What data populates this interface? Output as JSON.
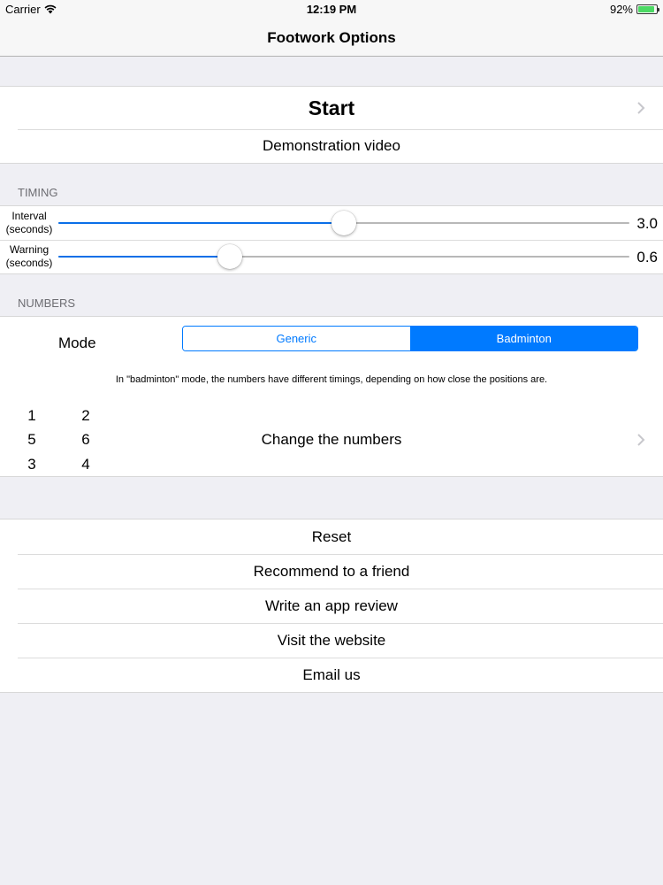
{
  "status": {
    "carrier": "Carrier",
    "time": "12:19 PM",
    "battery": "92%",
    "battery_level": 0.92
  },
  "nav": {
    "title": "Footwork Options"
  },
  "main": {
    "start": "Start",
    "demo": "Demonstration video"
  },
  "timing": {
    "header": "TIMING",
    "interval": {
      "label1": "Interval",
      "label2": "(seconds)",
      "value": "3.0",
      "fraction": 0.5
    },
    "warning": {
      "label1": "Warning",
      "label2": "(seconds)",
      "value": "0.6",
      "fraction": 0.3
    }
  },
  "numbers": {
    "header": "NUMBERS",
    "mode_label": "Mode",
    "options": [
      "Generic",
      "Badminton"
    ],
    "selected": "Badminton",
    "note": "In \"badminton\" mode, the numbers have different timings, depending on how close the positions are.",
    "grid": [
      "1",
      "2",
      "5",
      "6",
      "3",
      "4"
    ],
    "change": "Change the numbers"
  },
  "actions": {
    "reset": "Reset",
    "recommend": "Recommend to a friend",
    "review": "Write an app review",
    "website": "Visit the website",
    "email": "Email us"
  },
  "colors": {
    "accent": "#007aff",
    "slider": "#0a6fe8",
    "background": "#efeff4",
    "battery": "#4cd964"
  }
}
